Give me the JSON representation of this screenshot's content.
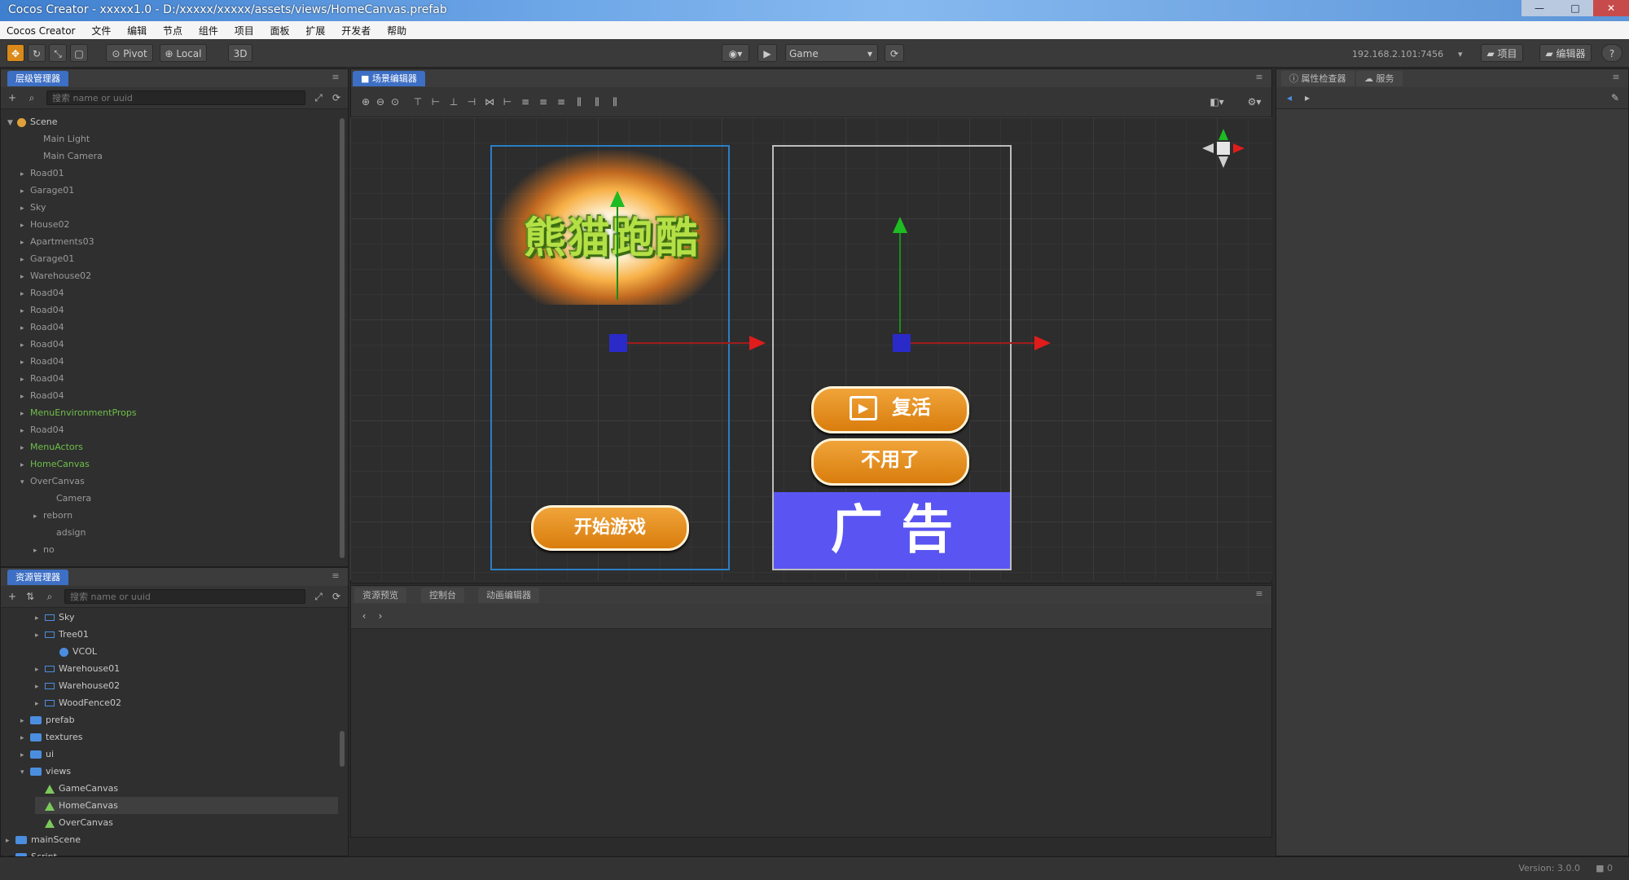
{
  "window": {
    "title": "Cocos Creator - xxxxx1.0 - D:/xxxxx/xxxxx/assets/views/HomeCanvas.prefab",
    "controls": [
      "—",
      "□",
      "✕"
    ]
  },
  "menu": [
    "Cocos Creator",
    "文件",
    "编辑",
    "节点",
    "组件",
    "项目",
    "面板",
    "扩展",
    "开发者",
    "帮助"
  ],
  "toolbar": {
    "pivot_label": "Pivot",
    "local_label": "Local",
    "mode_3d": "3D",
    "preview_target": "Game",
    "ip_label": "192.168.2.101:7456",
    "project_label": "项目",
    "editor_label": "编辑器"
  },
  "hierarchy": {
    "tab": "层级管理器",
    "search_placeholder": "搜索 name or uuid",
    "nodes": [
      {
        "label": "Scene",
        "indent": 0,
        "style": "normal",
        "arrow": "▼"
      },
      {
        "label": "Main Light",
        "indent": 2,
        "style": "dim",
        "arrow": ""
      },
      {
        "label": "Main Camera",
        "indent": 2,
        "style": "dim",
        "arrow": ""
      },
      {
        "label": "Road01",
        "indent": 1,
        "style": "dim",
        "arrow": "▸"
      },
      {
        "label": "Garage01",
        "indent": 1,
        "style": "dim",
        "arrow": "▸"
      },
      {
        "label": "Sky",
        "indent": 1,
        "style": "dim",
        "arrow": "▸"
      },
      {
        "label": "House02",
        "indent": 1,
        "style": "dim",
        "arrow": "▸"
      },
      {
        "label": "Apartments03",
        "indent": 1,
        "style": "dim",
        "arrow": "▸"
      },
      {
        "label": "Garage01",
        "indent": 1,
        "style": "dim",
        "arrow": "▸"
      },
      {
        "label": "Warehouse02",
        "indent": 1,
        "style": "dim",
        "arrow": "▸"
      },
      {
        "label": "Road04",
        "indent": 1,
        "style": "dim",
        "arrow": "▸"
      },
      {
        "label": "Road04",
        "indent": 1,
        "style": "dim",
        "arrow": "▸"
      },
      {
        "label": "Road04",
        "indent": 1,
        "style": "dim",
        "arrow": "▸"
      },
      {
        "label": "Road04",
        "indent": 1,
        "style": "dim",
        "arrow": "▸"
      },
      {
        "label": "Road04",
        "indent": 1,
        "style": "dim",
        "arrow": "▸"
      },
      {
        "label": "Road04",
        "indent": 1,
        "style": "dim",
        "arrow": "▸"
      },
      {
        "label": "Road04",
        "indent": 1,
        "style": "dim",
        "arrow": "▸"
      },
      {
        "label": "MenuEnvironmentProps",
        "indent": 1,
        "style": "green",
        "arrow": "▸"
      },
      {
        "label": "Road04",
        "indent": 1,
        "style": "dim",
        "arrow": "▸"
      },
      {
        "label": "MenuActors",
        "indent": 1,
        "style": "green",
        "arrow": "▸"
      },
      {
        "label": "HomeCanvas",
        "indent": 1,
        "style": "green",
        "arrow": "▸"
      },
      {
        "label": "OverCanvas",
        "indent": 1,
        "style": "dim",
        "arrow": "▾"
      },
      {
        "label": "Camera",
        "indent": 3,
        "style": "dim",
        "arrow": ""
      },
      {
        "label": "reborn",
        "indent": 2,
        "style": "dim",
        "arrow": "▸"
      },
      {
        "label": "adsign",
        "indent": 3,
        "style": "dim",
        "arrow": ""
      },
      {
        "label": "no",
        "indent": 2,
        "style": "dim",
        "arrow": "▸"
      }
    ]
  },
  "assets": {
    "tab": "资源管理器",
    "search_placeholder": "搜索 name or uuid",
    "nodes": [
      {
        "label": "Sky",
        "indent": 1,
        "icon": "node",
        "arrow": "▸"
      },
      {
        "label": "Tree01",
        "indent": 1,
        "icon": "node",
        "arrow": "▸"
      },
      {
        "label": "VCOL",
        "indent": 2,
        "icon": "scene",
        "arrow": ""
      },
      {
        "label": "Warehouse01",
        "indent": 1,
        "icon": "node",
        "arrow": "▸"
      },
      {
        "label": "Warehouse02",
        "indent": 1,
        "icon": "node",
        "arrow": "▸"
      },
      {
        "label": "WoodFence02",
        "indent": 1,
        "icon": "node",
        "arrow": "▸"
      },
      {
        "label": "prefab",
        "indent": 0,
        "icon": "folder",
        "arrow": "▸"
      },
      {
        "label": "textures",
        "indent": 0,
        "icon": "folder",
        "arrow": "▸"
      },
      {
        "label": "ui",
        "indent": 0,
        "icon": "folder",
        "arrow": "▸"
      },
      {
        "label": "views",
        "indent": 0,
        "icon": "folder",
        "arrow": "▾"
      },
      {
        "label": "GameCanvas",
        "indent": 1,
        "icon": "prefab",
        "arrow": ""
      },
      {
        "label": "HomeCanvas",
        "indent": 1,
        "icon": "prefab",
        "arrow": "",
        "selected": true
      },
      {
        "label": "OverCanvas",
        "indent": 1,
        "icon": "prefab",
        "arrow": ""
      },
      {
        "label": "mainScene",
        "indent": -1,
        "icon": "folder",
        "arrow": "▸"
      },
      {
        "label": "Script",
        "indent": -1,
        "icon": "folder",
        "arrow": "▸"
      }
    ]
  },
  "scene": {
    "tab": "场景编辑器",
    "logo_text": "熊猫跑酷",
    "start_button": "开始游戏",
    "revive_button": "复活",
    "decline_button": "不用了",
    "ad_text": "广 告"
  },
  "bottom": {
    "tabs": [
      "资源预览",
      "控制台",
      "动画编辑器"
    ]
  },
  "inspector": {
    "tabs": [
      "属性检查器",
      "服务"
    ]
  },
  "status": {
    "version": "Version: 3.0.0"
  },
  "colors": {
    "accent": "#d98a1a",
    "selection_tab": "#3d6fc4",
    "ad_block": "#5a55f2",
    "button_orange": "#e08d1e"
  }
}
